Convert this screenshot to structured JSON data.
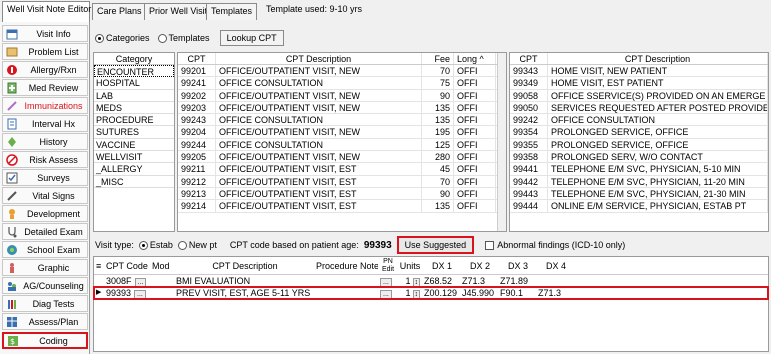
{
  "tabs": [
    {
      "label": "Well Visit Note Editor",
      "active": true
    },
    {
      "label": "Care Plans"
    },
    {
      "label": "Prior Well Visits"
    },
    {
      "label": "Templates"
    }
  ],
  "template_used": "Template used: 9-10 yrs",
  "sidebar": [
    {
      "label": "Visit Info",
      "icon": "calendar-icon"
    },
    {
      "label": "Problem List",
      "icon": "list-icon"
    },
    {
      "label": "Allergy/Rxn",
      "icon": "allergy-icon"
    },
    {
      "label": "Med Review",
      "icon": "medication-icon"
    },
    {
      "label": "Immunizations",
      "icon": "syringe-icon"
    },
    {
      "label": "Interval Hx",
      "icon": "document-icon"
    },
    {
      "label": "History",
      "icon": "history-icon"
    },
    {
      "label": "Risk Assess",
      "icon": "warning-icon"
    },
    {
      "label": "Surveys",
      "icon": "survey-icon"
    },
    {
      "label": "Vital Signs",
      "icon": "pen-icon"
    },
    {
      "label": "Development",
      "icon": "development-icon"
    },
    {
      "label": "Detailed Exam",
      "icon": "stethoscope-icon"
    },
    {
      "label": "School Exam",
      "icon": "school-icon"
    },
    {
      "label": "Graphic",
      "icon": "graphic-icon"
    },
    {
      "label": "AG/Counseling",
      "icon": "counseling-icon"
    },
    {
      "label": "Diag Tests",
      "icon": "tests-icon"
    },
    {
      "label": "Assess/Plan",
      "icon": "plan-icon"
    },
    {
      "label": "Coding",
      "icon": "coding-icon",
      "highlighted": true
    }
  ],
  "mode": {
    "categories": "Categories",
    "templates": "Templates",
    "lookup": "Lookup CPT"
  },
  "categories": {
    "header": "Category",
    "items": [
      "ENCOUNTER",
      "HOSPITAL",
      "LAB",
      "MEDS",
      "PROCEDURE",
      "SUTURES",
      "VACCINE",
      "WELLVISIT",
      "_ALLERGY",
      "_MISC"
    ]
  },
  "left_grid": {
    "headers": {
      "cpt": "CPT",
      "desc": "CPT Description",
      "fee": "Fee",
      "long": "Long"
    },
    "rows": [
      {
        "cpt": "99201",
        "desc": "OFFICE/OUTPATIENT VISIT, NEW",
        "fee": "70",
        "long": "OFFI"
      },
      {
        "cpt": "99241",
        "desc": "OFFICE CONSULTATION",
        "fee": "75",
        "long": "OFFI"
      },
      {
        "cpt": "99202",
        "desc": "OFFICE/OUTPATIENT VISIT, NEW",
        "fee": "90",
        "long": "OFFI"
      },
      {
        "cpt": "99203",
        "desc": "OFFICE/OUTPATIENT VISIT, NEW",
        "fee": "135",
        "long": "OFFI"
      },
      {
        "cpt": "99243",
        "desc": "OFFICE CONSULTATION",
        "fee": "135",
        "long": "OFFI"
      },
      {
        "cpt": "99204",
        "desc": "OFFICE/OUTPATIENT VISIT, NEW",
        "fee": "195",
        "long": "OFFI"
      },
      {
        "cpt": "99244",
        "desc": "OFFICE CONSULTATION",
        "fee": "125",
        "long": "OFFI"
      },
      {
        "cpt": "99205",
        "desc": "OFFICE/OUTPATIENT VISIT, NEW",
        "fee": "280",
        "long": "OFFI"
      },
      {
        "cpt": "99211",
        "desc": "OFFICE/OUTPATIENT VISIT, EST",
        "fee": "45",
        "long": "OFFI"
      },
      {
        "cpt": "99212",
        "desc": "OFFICE/OUTPATIENT VISIT, EST",
        "fee": "70",
        "long": "OFFI"
      },
      {
        "cpt": "99213",
        "desc": "OFFICE/OUTPATIENT VISIT, EST",
        "fee": "90",
        "long": "OFFI"
      },
      {
        "cpt": "99214",
        "desc": "OFFICE/OUTPATIENT VISIT, EST",
        "fee": "135",
        "long": "OFFI"
      }
    ]
  },
  "right_grid": {
    "headers": {
      "cpt": "CPT",
      "desc": "CPT Description"
    },
    "rows": [
      {
        "cpt": "99343",
        "desc": "HOME VISIT, NEW PATIENT"
      },
      {
        "cpt": "99349",
        "desc": "HOME VISIT, EST PATIENT"
      },
      {
        "cpt": "99058",
        "desc": "OFFICE SSERVICE(S) PROVIDED ON AN EMERGE"
      },
      {
        "cpt": "99050",
        "desc": "SERVICES REQUESTED AFTER POSTED PROVIDED"
      },
      {
        "cpt": "99242",
        "desc": "OFFICE CONSULTATION"
      },
      {
        "cpt": "99354",
        "desc": "PROLONGED SERVICE, OFFICE"
      },
      {
        "cpt": "99355",
        "desc": "PROLONGED SERVICE, OFFICE"
      },
      {
        "cpt": "99358",
        "desc": "PROLONGED SERV, W/O CONTACT"
      },
      {
        "cpt": "99441",
        "desc": "TELEPHONE E/M SVC, PHYSICIAN, 5-10 MIN"
      },
      {
        "cpt": "99442",
        "desc": "TELEPHONE E/M SVC, PHYSICIAN, 11-20 MIN"
      },
      {
        "cpt": "99443",
        "desc": "TELEPHONE E/M SVC, PHYSICIAN, 21-30 MIN"
      },
      {
        "cpt": "99444",
        "desc": "ONLINE E/M SERVICE, PHYSICIAN, ESTAB PT"
      }
    ]
  },
  "visit": {
    "label": "Visit type:",
    "estab": "Estab",
    "new_pt": "New pt",
    "age_label": "CPT code based on patient age:",
    "age_code": "99393",
    "use_suggested": "Use Suggested",
    "abnormal": "Abnormal findings (ICD-10 only)"
  },
  "bottom_grid": {
    "headers": {
      "code": "CPT Code",
      "mod": "Mod",
      "desc": "CPT Description",
      "note": "Procedure Note",
      "pn": "PN Edit",
      "units": "Units",
      "dx1": "DX 1",
      "dx2": "DX 2",
      "dx3": "DX 3",
      "dx4": "DX 4"
    },
    "rows": [
      {
        "code": "3008F",
        "mod": "",
        "desc": "BMI EVALUATION",
        "note": "",
        "units": "1",
        "dx1": "Z68.52",
        "dx2": "Z71.3",
        "dx3": "Z71.89",
        "dx4": ""
      },
      {
        "code": "99393",
        "mod": "",
        "desc": "PREV VISIT, EST, AGE 5-11 YRS",
        "note": "",
        "units": "1",
        "dx1": "Z00.129",
        "dx2": "J45.990",
        "dx3": "F90.1",
        "dx4": "Z71.3",
        "current": true
      }
    ]
  },
  "colors": {
    "highlight": "#d8131b",
    "immunizations": "#d8131b"
  }
}
